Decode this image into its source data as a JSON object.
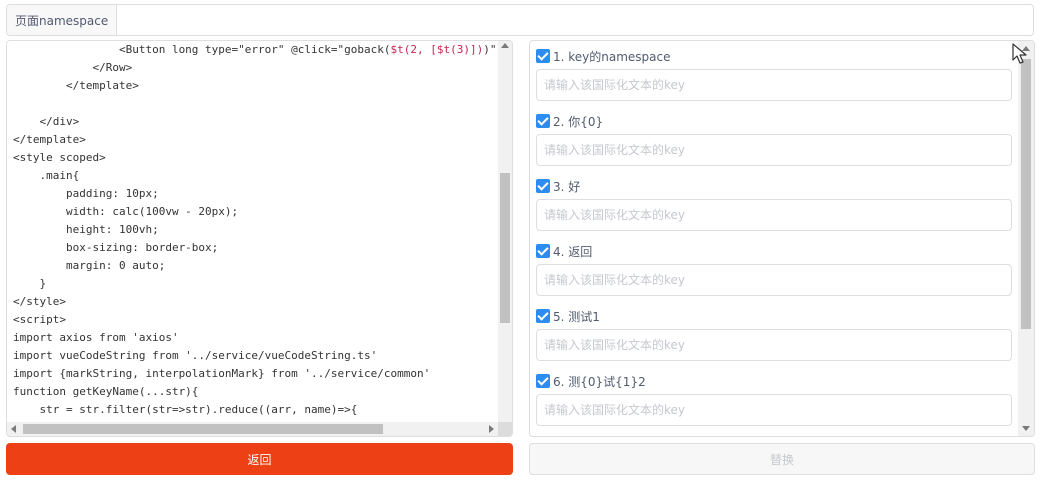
{
  "namespace": {
    "label": "页面namespace",
    "value": ""
  },
  "code_lines": [
    {
      "pre": "                <Button long type=\"error\" @click=\"goback(",
      "hl": "$t(2, [$t(3)])",
      "post": ")\""
    },
    {
      "pre": "            </Row>",
      "hl": "",
      "post": ""
    },
    {
      "pre": "        </template>",
      "hl": "",
      "post": ""
    },
    {
      "pre": "",
      "hl": "",
      "post": ""
    },
    {
      "pre": "    </div>",
      "hl": "",
      "post": ""
    },
    {
      "pre": "</template>",
      "hl": "",
      "post": ""
    },
    {
      "pre": "<style scoped>",
      "hl": "",
      "post": ""
    },
    {
      "pre": "    .main{",
      "hl": "",
      "post": ""
    },
    {
      "pre": "        padding: 10px;",
      "hl": "",
      "post": ""
    },
    {
      "pre": "        width: calc(100vw - 20px);",
      "hl": "",
      "post": ""
    },
    {
      "pre": "        height: 100vh;",
      "hl": "",
      "post": ""
    },
    {
      "pre": "        box-sizing: border-box;",
      "hl": "",
      "post": ""
    },
    {
      "pre": "        margin: 0 auto;",
      "hl": "",
      "post": ""
    },
    {
      "pre": "    }",
      "hl": "",
      "post": ""
    },
    {
      "pre": "</style>",
      "hl": "",
      "post": ""
    },
    {
      "pre": "<script>",
      "hl": "",
      "post": ""
    },
    {
      "pre": "import axios from 'axios'",
      "hl": "",
      "post": ""
    },
    {
      "pre": "import vueCodeString from '../service/vueCodeString.ts'",
      "hl": "",
      "post": ""
    },
    {
      "pre": "import {markString, interpolationMark} from '../service/common'",
      "hl": "",
      "post": ""
    },
    {
      "pre": "function getKeyName(...str){",
      "hl": "",
      "post": ""
    },
    {
      "pre": "    str = str.filter(str=>str).reduce((arr, name)=>{",
      "hl": "",
      "post": ""
    }
  ],
  "items": [
    {
      "label": "1. key的namespace",
      "checked": true,
      "value": ""
    },
    {
      "label": "2. 你{0}",
      "checked": true,
      "value": ""
    },
    {
      "label": "3. 好",
      "checked": true,
      "value": ""
    },
    {
      "label": "4. 返回",
      "checked": true,
      "value": ""
    },
    {
      "label": "5. 测试1",
      "checked": true,
      "value": ""
    },
    {
      "label": "6. 测{0}试{1}2",
      "checked": true,
      "value": ""
    }
  ],
  "item_placeholder": "请输入该国际化文本的key",
  "buttons": {
    "back": "返回",
    "replace": "替换"
  },
  "colors": {
    "accent": "#2d8cf0",
    "error": "#ed4014",
    "highlight": "#c7254e"
  },
  "icons": {
    "checkbox": "checkbox-checked-icon",
    "cursor": "mouse-pointer-icon"
  }
}
